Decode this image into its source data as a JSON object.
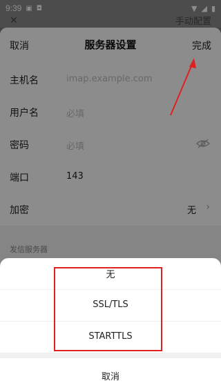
{
  "status_bar": {
    "time": "9:39"
  },
  "background_screen": {
    "title_fragment": "手动配置"
  },
  "server_settings": {
    "cancel_label": "取消",
    "title": "服务器设置",
    "done_label": "完成",
    "fields": {
      "hostname": {
        "label": "主机名",
        "placeholder": "imap.example.com"
      },
      "username": {
        "label": "用户名",
        "placeholder": "必填"
      },
      "password": {
        "label": "密码",
        "placeholder": "必填"
      },
      "port": {
        "label": "端口",
        "value": "143"
      },
      "encryption": {
        "label": "加密",
        "value": "无"
      }
    },
    "outgoing_section_title": "发信服务器"
  },
  "encryption_sheet": {
    "options": [
      "无",
      "SSL/TLS",
      "STARTTLS"
    ],
    "cancel_label": "取消"
  },
  "colors": {
    "annotation": "#e02020",
    "overlay": "rgba(0,0,0,0.45)"
  }
}
